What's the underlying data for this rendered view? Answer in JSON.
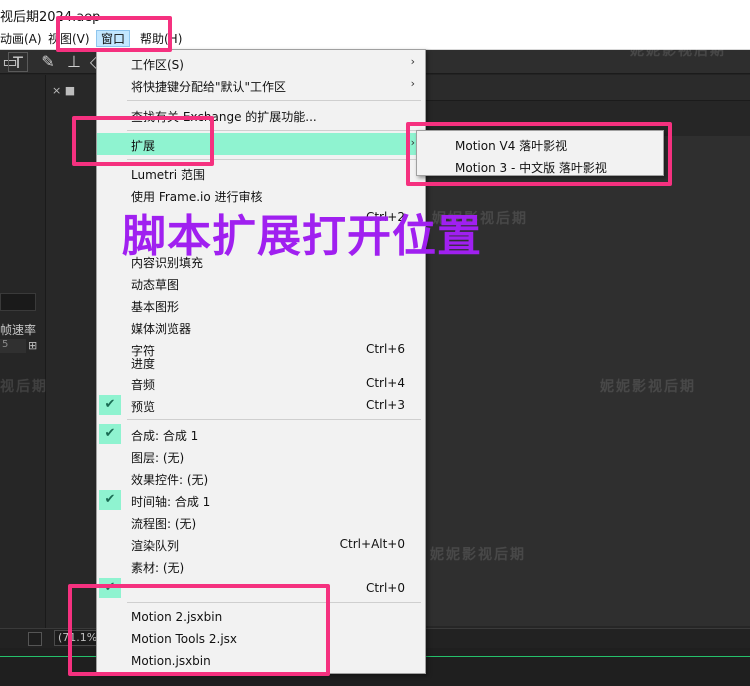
{
  "window": {
    "title": "视后期2024.aep"
  },
  "menubar": {
    "items": [
      {
        "label": "动画(A)"
      },
      {
        "label": "视图(V)"
      },
      {
        "label": "窗口"
      },
      {
        "label": "帮助(H)"
      }
    ]
  },
  "left_panel": {
    "frame_rate_label": "帧速率",
    "field_value": "5"
  },
  "status": {
    "zoom": "(71.1%)"
  },
  "menu": {
    "items": [
      {
        "label": "工作区(S)",
        "submenu": true
      },
      {
        "label": "将快捷键分配给\"默认\"工作区",
        "submenu": true
      },
      {
        "label": "查找有关 Exchange 的扩展功能..."
      },
      {
        "label": "扩展",
        "submenu": true,
        "highlighted": true
      },
      {
        "label": "Lumetri 范围"
      },
      {
        "label": "使用 Frame.io 进行审核"
      },
      {
        "label": "",
        "shortcut": "Ctrl+2"
      },
      {
        "label": ""
      },
      {
        "label": "内容识别填充"
      },
      {
        "label": "动态草图"
      },
      {
        "label": "基本图形"
      },
      {
        "label": "媒体浏览器"
      },
      {
        "label": "字符",
        "label2": "进度",
        "shortcut": "Ctrl+6"
      },
      {
        "label": "音频",
        "shortcut": "Ctrl+4"
      },
      {
        "label": "预览",
        "shortcut": "Ctrl+3",
        "checked": true
      },
      {
        "label": "合成: 合成 1",
        "checked": true
      },
      {
        "label": "图层: (无)"
      },
      {
        "label": "效果控件: (无)"
      },
      {
        "label": "时间轴: 合成 1",
        "checked": true
      },
      {
        "label": "流程图: (无)"
      },
      {
        "label": "渲染队列",
        "shortcut": "Ctrl+Alt+0"
      },
      {
        "label": "素材: (无)"
      },
      {
        "label": "",
        "shortcut": "Ctrl+0",
        "checked": true
      },
      {
        "label": "Motion 2.jsxbin"
      },
      {
        "label": "Motion Tools 2.jsx"
      },
      {
        "label": "Motion.jsxbin"
      }
    ]
  },
  "submenu": {
    "items": [
      {
        "label": "Motion V4 落叶影视"
      },
      {
        "label": "Motion 3 - 中文版 落叶影视"
      }
    ]
  },
  "annotation": {
    "text": "脚本扩展打开位置",
    "color": "#a020f0",
    "box_color": "#f5317f"
  },
  "watermarks": [
    "妮妮影视后期",
    "妮妮影视后期",
    "妮妮影视后期",
    "视后期",
    "妮妮影视后期"
  ],
  "colors": {
    "highlight": "#8ff3d0",
    "background": "#232323"
  }
}
